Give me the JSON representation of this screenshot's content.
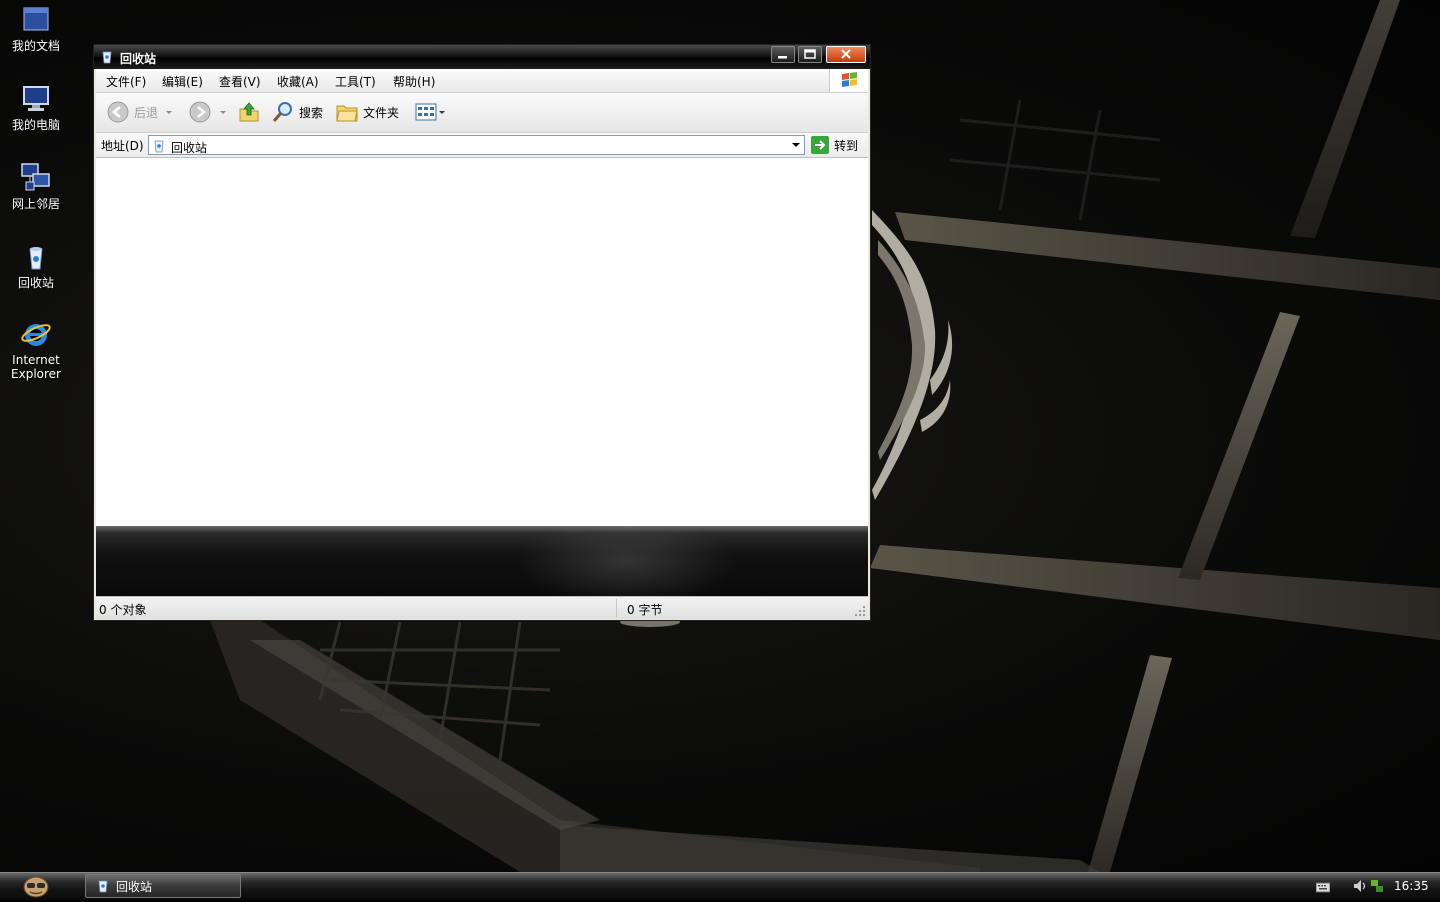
{
  "desktop": {
    "icons": [
      {
        "label": "我的文档",
        "icon": "my-documents-icon"
      },
      {
        "label": "我的电脑",
        "icon": "my-computer-icon"
      },
      {
        "label": "网上邻居",
        "icon": "network-places-icon"
      },
      {
        "label": "回收站",
        "icon": "recycle-bin-icon"
      },
      {
        "label_line1": "Internet",
        "label_line2": "Explorer",
        "icon": "internet-explorer-icon"
      }
    ]
  },
  "window": {
    "title": "回收站",
    "menu": [
      "文件(F)",
      "编辑(E)",
      "查看(V)",
      "收藏(A)",
      "工具(T)",
      "帮助(H)"
    ],
    "toolbar": {
      "back_label": "后退",
      "search_label": "搜索",
      "folders_label": "文件夹"
    },
    "address": {
      "label": "地址(D)",
      "value": "回收站",
      "go_label": "转到"
    },
    "status": {
      "objects": "0 个对象",
      "size": "0 字节"
    }
  },
  "taskbar": {
    "task_label": "回收站",
    "clock": "16:35"
  },
  "colors": {
    "titlebar": "#000000",
    "close_button": "#d9532a",
    "desktop": "#0b0b0a"
  }
}
